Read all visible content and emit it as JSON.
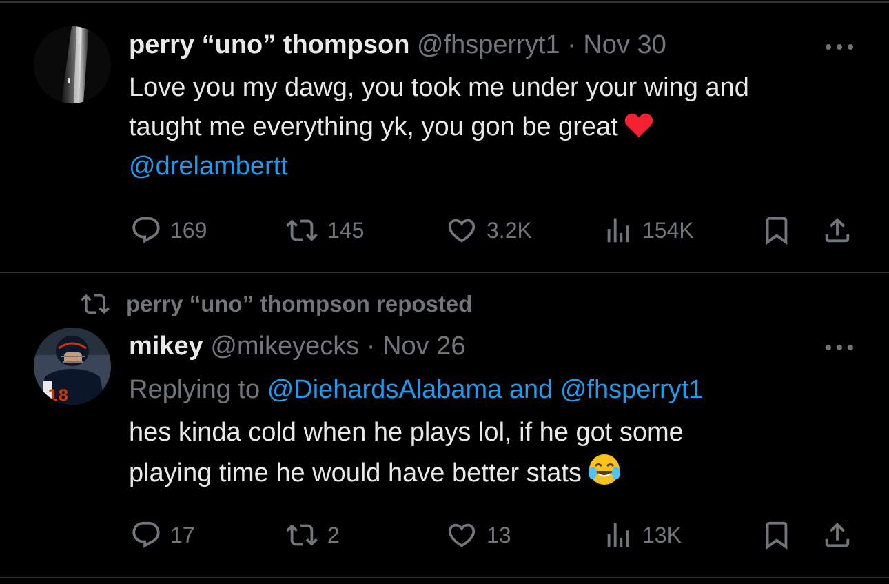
{
  "tweets": [
    {
      "author": {
        "name": "perry “uno” thompson",
        "handle": "@fhsperryt1",
        "date": "Nov 30",
        "avatar": "dark-light-beam-avatar"
      },
      "text_lines": [
        "Love you my dawg, you took me under your wing and",
        "taught me everything yk, you gon be great"
      ],
      "mention": "@drelambertt",
      "emoji": "red-heart",
      "actions": {
        "replies": "169",
        "reposts": "145",
        "likes": "3.2K",
        "views": "154K"
      }
    },
    {
      "repost_label": "perry “uno” thompson reposted",
      "author": {
        "name": "mikey",
        "handle": "@mikeyecks",
        "date": "Nov 26",
        "avatar": "football-player-avatar"
      },
      "replying_to": {
        "prefix": "Replying to",
        "first": "@DiehardsAlabama",
        "joiner": "and",
        "second": "@fhsperryt1"
      },
      "avatar_jersey": "18",
      "text_lines": [
        "hes kinda cold when he plays lol, if he got some",
        "playing time he would have better stats"
      ],
      "emoji": "face-with-tears-of-joy",
      "actions": {
        "replies": "17",
        "reposts": "2",
        "likes": "13",
        "views": "13K"
      }
    }
  ],
  "separator": " · ",
  "colors": {
    "background": "#000000",
    "text": "#e7e9ea",
    "muted": "#71767b",
    "link": "#1d9bf0",
    "divider": "#2f3336",
    "heart": "#f91880"
  }
}
